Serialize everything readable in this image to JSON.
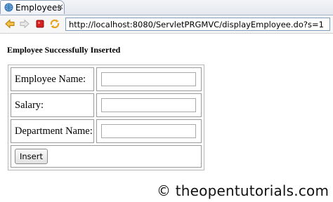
{
  "tab": {
    "title": "Employees",
    "close_glyph": "✕",
    "icon": "globe-icon"
  },
  "toolbar": {
    "back_icon": "arrow-left-icon",
    "forward_icon": "arrow-right-icon",
    "stop_icon": "stop-icon",
    "refresh_icon": "refresh-icon",
    "url": "http://localhost:8080/ServletPRGMVC/displayEmployee.do?s=1"
  },
  "page": {
    "message": "Employee Successfully Inserted",
    "form": {
      "name_label": "Employee Name:",
      "salary_label": "Salary:",
      "department_label": "Department Name:",
      "name_value": "",
      "salary_value": "",
      "department_value": "",
      "submit_label": "Insert"
    }
  },
  "watermark": "© theopentutorials.com",
  "colors": {
    "back_arrow": "#e8a317",
    "forward_arrow": "#c8c8c8",
    "stop": "#d62020",
    "refresh": "#e8a317"
  }
}
